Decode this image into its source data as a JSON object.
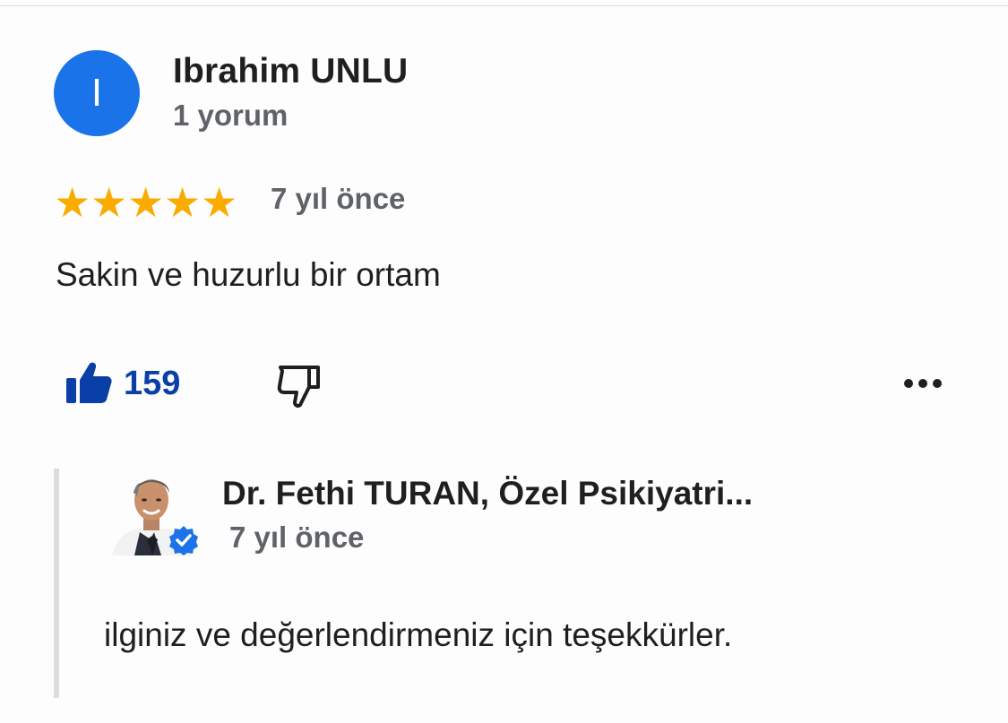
{
  "review": {
    "author_initial": "I",
    "author_name": "Ibrahim UNLU",
    "review_count": "1 yorum",
    "rating_stars": 5,
    "rating_max": 5,
    "date": "7 yıl önce",
    "text": "Sakin ve huzurlu bir ortam",
    "like_count": "159",
    "accent_color": "#1a73e8",
    "star_color": "#f9ab00",
    "like_color": "#0b3fa8"
  },
  "actions": {
    "like_icon": "thumbs-up-icon",
    "dislike_icon": "thumbs-down-icon",
    "more_icon": "more-horizontal-icon"
  },
  "reply": {
    "owner_name": "Dr. Fethi TURAN, Özel Psikiyatri...",
    "date": "7 yıl önce",
    "text": "ilginiz ve değerlendirmeniz için teşekkürler.",
    "verified_icon": "verified-badge-icon",
    "verified_color": "#1a73e8"
  }
}
